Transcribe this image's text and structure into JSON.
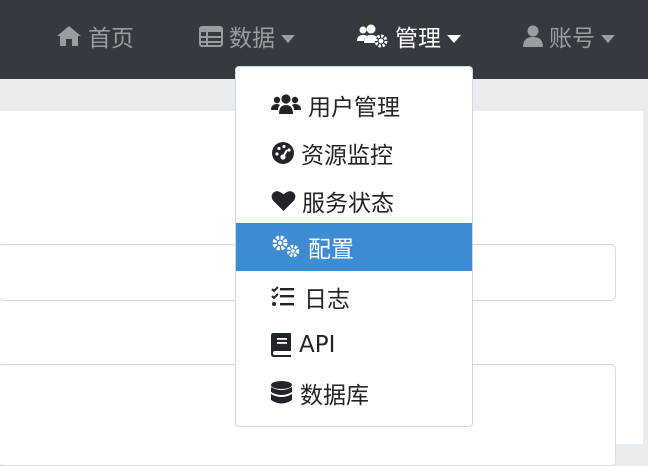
{
  "navbar": {
    "items": [
      {
        "label": "首页",
        "icon": "home-icon",
        "has_caret": false
      },
      {
        "label": "数据",
        "icon": "table-icon",
        "has_caret": true
      },
      {
        "label": "管理",
        "icon": "users-cog-icon",
        "has_caret": true,
        "active": true
      },
      {
        "label": "账号",
        "icon": "user-icon",
        "has_caret": true
      }
    ]
  },
  "dropdown": {
    "items": [
      {
        "label": "用户管理",
        "icon": "users-icon"
      },
      {
        "label": "资源监控",
        "icon": "gauge-icon"
      },
      {
        "label": "服务状态",
        "icon": "heart-icon"
      },
      {
        "label": "配置",
        "icon": "cogs-icon",
        "active": true
      },
      {
        "label": "日志",
        "icon": "tasks-icon"
      },
      {
        "label": "API",
        "icon": "book-icon"
      },
      {
        "label": "数据库",
        "icon": "database-icon"
      }
    ]
  },
  "colors": {
    "navbar_bg": "#343a40",
    "nav_text": "#9a9da0",
    "nav_active_text": "#ffffff",
    "dropdown_active_bg": "#3d8bd1",
    "page_bg": "#e9ecef"
  }
}
